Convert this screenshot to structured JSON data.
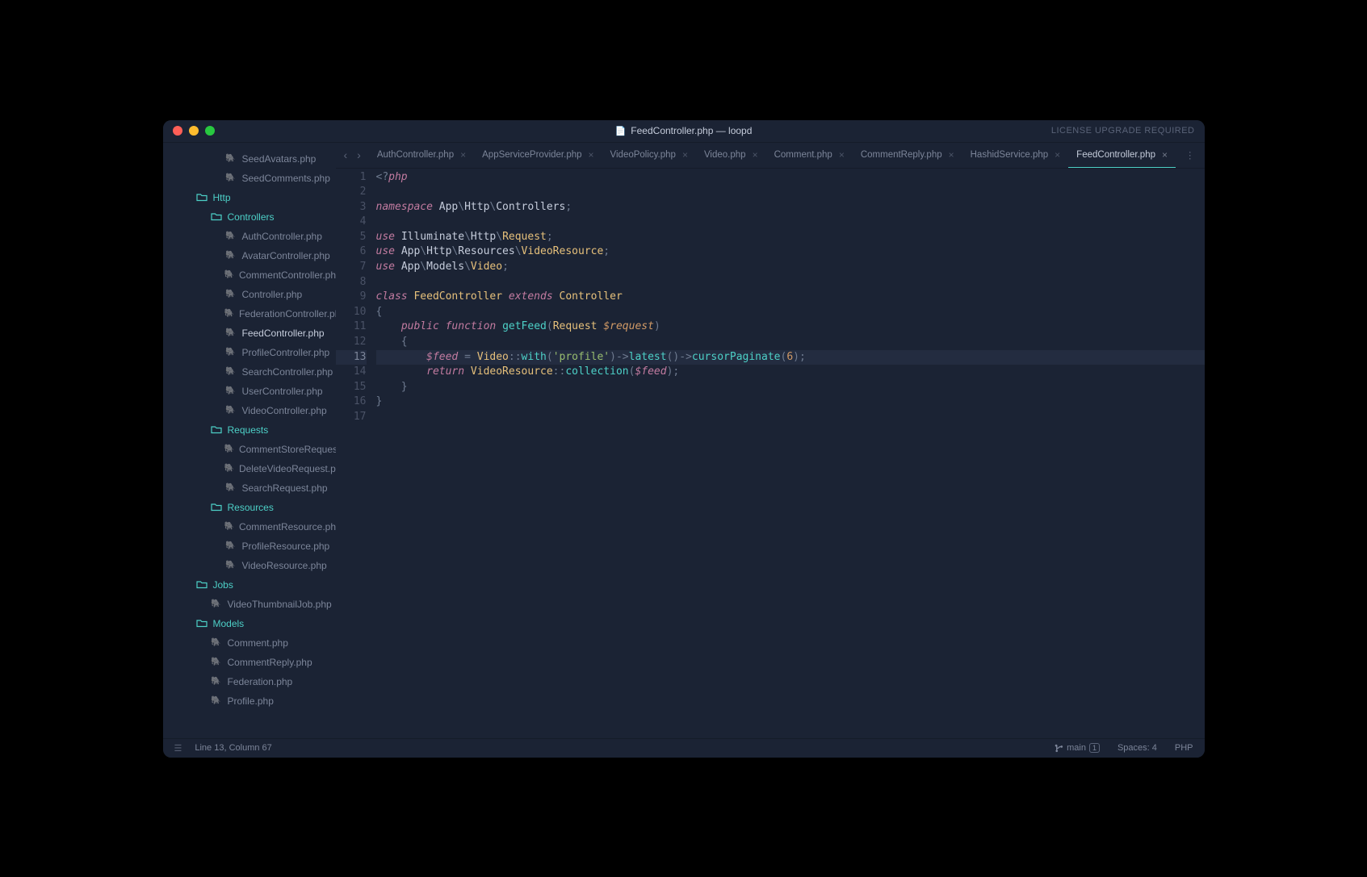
{
  "window": {
    "title": "FeedController.php — loopd",
    "license_notice": "LICENSE UPGRADE REQUIRED"
  },
  "sidebar": {
    "items": [
      {
        "type": "file",
        "name": "SeedAvatars.php",
        "indent": 3
      },
      {
        "type": "file",
        "name": "SeedComments.php",
        "indent": 3
      },
      {
        "type": "folder",
        "name": "Http",
        "indent": 1
      },
      {
        "type": "folder",
        "name": "Controllers",
        "indent": 2
      },
      {
        "type": "file",
        "name": "AuthController.php",
        "indent": 3
      },
      {
        "type": "file",
        "name": "AvatarController.php",
        "indent": 3
      },
      {
        "type": "file",
        "name": "CommentController.php",
        "indent": 3
      },
      {
        "type": "file",
        "name": "Controller.php",
        "indent": 3
      },
      {
        "type": "file",
        "name": "FederationController.php",
        "indent": 3
      },
      {
        "type": "file",
        "name": "FeedController.php",
        "indent": 3,
        "active": true
      },
      {
        "type": "file",
        "name": "ProfileController.php",
        "indent": 3
      },
      {
        "type": "file",
        "name": "SearchController.php",
        "indent": 3
      },
      {
        "type": "file",
        "name": "UserController.php",
        "indent": 3
      },
      {
        "type": "file",
        "name": "VideoController.php",
        "indent": 3
      },
      {
        "type": "folder",
        "name": "Requests",
        "indent": 2
      },
      {
        "type": "file",
        "name": "CommentStoreRequest.php",
        "indent": 3
      },
      {
        "type": "file",
        "name": "DeleteVideoRequest.php",
        "indent": 3
      },
      {
        "type": "file",
        "name": "SearchRequest.php",
        "indent": 3
      },
      {
        "type": "folder",
        "name": "Resources",
        "indent": 2
      },
      {
        "type": "file",
        "name": "CommentResource.php",
        "indent": 3
      },
      {
        "type": "file",
        "name": "ProfileResource.php",
        "indent": 3
      },
      {
        "type": "file",
        "name": "VideoResource.php",
        "indent": 3
      },
      {
        "type": "folder",
        "name": "Jobs",
        "indent": 1
      },
      {
        "type": "file",
        "name": "VideoThumbnailJob.php",
        "indent": 2
      },
      {
        "type": "folder",
        "name": "Models",
        "indent": 1
      },
      {
        "type": "file",
        "name": "Comment.php",
        "indent": 2
      },
      {
        "type": "file",
        "name": "CommentReply.php",
        "indent": 2
      },
      {
        "type": "file",
        "name": "Federation.php",
        "indent": 2
      },
      {
        "type": "file",
        "name": "Profile.php",
        "indent": 2
      }
    ]
  },
  "tabs": [
    {
      "label": "AuthController.php",
      "active": false
    },
    {
      "label": "AppServiceProvider.php",
      "active": false
    },
    {
      "label": "VideoPolicy.php",
      "active": false
    },
    {
      "label": "Video.php",
      "active": false
    },
    {
      "label": "Comment.php",
      "active": false
    },
    {
      "label": "CommentReply.php",
      "active": false
    },
    {
      "label": "HashidService.php",
      "active": false
    },
    {
      "label": "FeedController.php",
      "active": true
    }
  ],
  "editor": {
    "highlighted_line": 13,
    "lines": [
      {
        "n": 1,
        "tokens": [
          {
            "t": "<?",
            "c": "tok-sep"
          },
          {
            "t": "php",
            "c": "tok-kw"
          }
        ]
      },
      {
        "n": 2,
        "tokens": []
      },
      {
        "n": 3,
        "tokens": [
          {
            "t": "namespace ",
            "c": "tok-kw"
          },
          {
            "t": "App",
            "c": "tok-ns"
          },
          {
            "t": "\\",
            "c": "tok-sep"
          },
          {
            "t": "Http",
            "c": "tok-ns"
          },
          {
            "t": "\\",
            "c": "tok-sep"
          },
          {
            "t": "Controllers",
            "c": "tok-ns"
          },
          {
            "t": ";",
            "c": "tok-punc"
          }
        ]
      },
      {
        "n": 4,
        "tokens": []
      },
      {
        "n": 5,
        "tokens": [
          {
            "t": "use ",
            "c": "tok-kw"
          },
          {
            "t": "Illuminate",
            "c": "tok-ns"
          },
          {
            "t": "\\",
            "c": "tok-sep"
          },
          {
            "t": "Http",
            "c": "tok-ns"
          },
          {
            "t": "\\",
            "c": "tok-sep"
          },
          {
            "t": "Request",
            "c": "tok-cls"
          },
          {
            "t": ";",
            "c": "tok-punc"
          }
        ]
      },
      {
        "n": 6,
        "tokens": [
          {
            "t": "use ",
            "c": "tok-kw"
          },
          {
            "t": "App",
            "c": "tok-ns"
          },
          {
            "t": "\\",
            "c": "tok-sep"
          },
          {
            "t": "Http",
            "c": "tok-ns"
          },
          {
            "t": "\\",
            "c": "tok-sep"
          },
          {
            "t": "Resources",
            "c": "tok-ns"
          },
          {
            "t": "\\",
            "c": "tok-sep"
          },
          {
            "t": "VideoResource",
            "c": "tok-cls"
          },
          {
            "t": ";",
            "c": "tok-punc"
          }
        ]
      },
      {
        "n": 7,
        "tokens": [
          {
            "t": "use ",
            "c": "tok-kw"
          },
          {
            "t": "App",
            "c": "tok-ns"
          },
          {
            "t": "\\",
            "c": "tok-sep"
          },
          {
            "t": "Models",
            "c": "tok-ns"
          },
          {
            "t": "\\",
            "c": "tok-sep"
          },
          {
            "t": "Video",
            "c": "tok-cls"
          },
          {
            "t": ";",
            "c": "tok-punc"
          }
        ]
      },
      {
        "n": 8,
        "tokens": []
      },
      {
        "n": 9,
        "tokens": [
          {
            "t": "class ",
            "c": "tok-kw"
          },
          {
            "t": "FeedController",
            "c": "tok-cls"
          },
          {
            "t": " extends ",
            "c": "tok-kw"
          },
          {
            "t": "Controller",
            "c": "tok-cls"
          }
        ]
      },
      {
        "n": 10,
        "tokens": [
          {
            "t": "{",
            "c": "tok-punc"
          }
        ]
      },
      {
        "n": 11,
        "tokens": [
          {
            "t": "    ",
            "c": ""
          },
          {
            "t": "public ",
            "c": "tok-kw"
          },
          {
            "t": "function ",
            "c": "tok-kw"
          },
          {
            "t": "getFeed",
            "c": "tok-fn"
          },
          {
            "t": "(",
            "c": "tok-punc"
          },
          {
            "t": "Request",
            "c": "tok-cls"
          },
          {
            "t": " ",
            "c": ""
          },
          {
            "t": "$request",
            "c": "tok-param"
          },
          {
            "t": ")",
            "c": "tok-punc"
          }
        ]
      },
      {
        "n": 12,
        "tokens": [
          {
            "t": "    {",
            "c": "tok-punc"
          }
        ]
      },
      {
        "n": 13,
        "tokens": [
          {
            "t": "        ",
            "c": ""
          },
          {
            "t": "$feed",
            "c": "tok-var"
          },
          {
            "t": " = ",
            "c": "tok-punc"
          },
          {
            "t": "Video",
            "c": "tok-cls"
          },
          {
            "t": "::",
            "c": "tok-sep"
          },
          {
            "t": "with",
            "c": "tok-static"
          },
          {
            "t": "(",
            "c": "tok-punc"
          },
          {
            "t": "'profile'",
            "c": "tok-str"
          },
          {
            "t": ")->",
            "c": "tok-punc"
          },
          {
            "t": "latest",
            "c": "tok-method"
          },
          {
            "t": "()->",
            "c": "tok-punc"
          },
          {
            "t": "cursorPaginate",
            "c": "tok-method"
          },
          {
            "t": "(",
            "c": "tok-punc"
          },
          {
            "t": "6",
            "c": "tok-num"
          },
          {
            "t": ");",
            "c": "tok-punc"
          }
        ]
      },
      {
        "n": 14,
        "tokens": [
          {
            "t": "        ",
            "c": ""
          },
          {
            "t": "return ",
            "c": "tok-kw"
          },
          {
            "t": "VideoResource",
            "c": "tok-cls"
          },
          {
            "t": "::",
            "c": "tok-sep"
          },
          {
            "t": "collection",
            "c": "tok-static"
          },
          {
            "t": "(",
            "c": "tok-punc"
          },
          {
            "t": "$feed",
            "c": "tok-var"
          },
          {
            "t": ");",
            "c": "tok-punc"
          }
        ]
      },
      {
        "n": 15,
        "tokens": [
          {
            "t": "    }",
            "c": "tok-punc"
          }
        ]
      },
      {
        "n": 16,
        "tokens": [
          {
            "t": "}",
            "c": "tok-punc"
          }
        ]
      },
      {
        "n": 17,
        "tokens": []
      }
    ]
  },
  "statusbar": {
    "position": "Line 13, Column 67",
    "branch": "main",
    "branch_count": "1",
    "spaces": "Spaces: 4",
    "lang": "PHP"
  }
}
